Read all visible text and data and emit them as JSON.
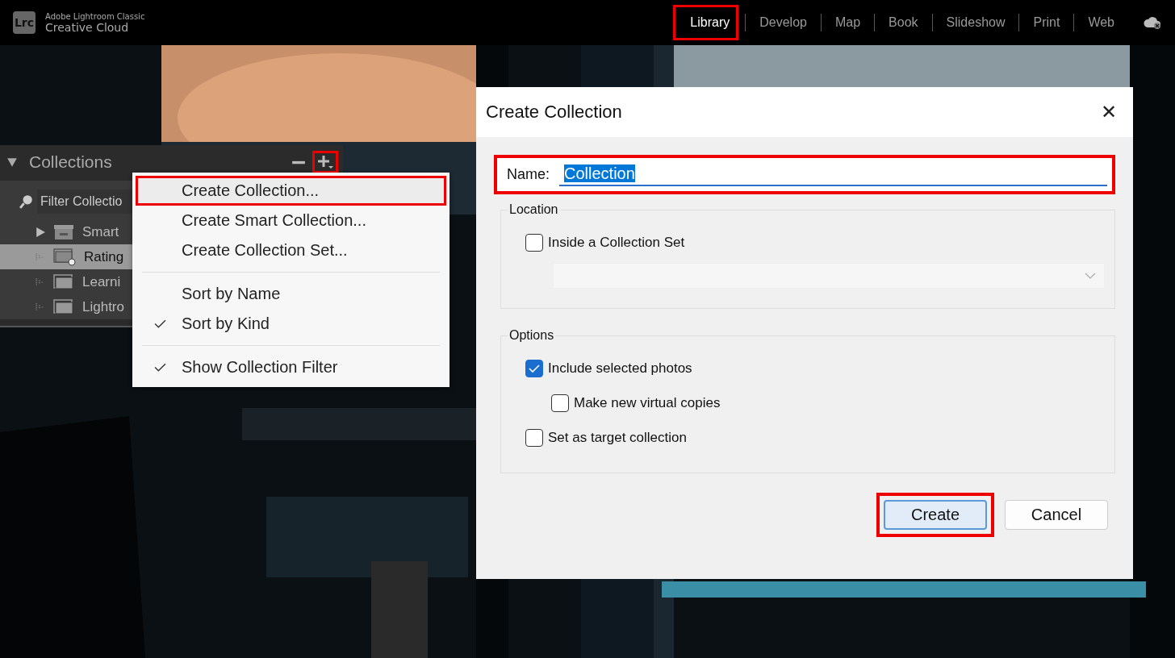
{
  "app": {
    "logo": "Lrc",
    "product": "Adobe Lightroom Classic",
    "suite": "Creative Cloud"
  },
  "modules": [
    {
      "label": "Library",
      "selected": true,
      "highlighted": true
    },
    {
      "label": "Develop",
      "selected": false,
      "highlighted": false
    },
    {
      "label": "Map",
      "selected": false,
      "highlighted": false
    },
    {
      "label": "Book",
      "selected": false,
      "highlighted": false
    },
    {
      "label": "Slideshow",
      "selected": false,
      "highlighted": false
    },
    {
      "label": "Print",
      "selected": false,
      "highlighted": false
    },
    {
      "label": "Web",
      "selected": false,
      "highlighted": false
    }
  ],
  "collections_panel": {
    "title": "Collections",
    "expanded": true,
    "add_highlighted": true,
    "filter_placeholder": "Filter Collectio",
    "items": [
      {
        "label": "Smart",
        "kind": "set",
        "selected": false
      },
      {
        "label": "Rating",
        "kind": "smart",
        "selected": true
      },
      {
        "label": "Learni",
        "kind": "collection",
        "selected": false
      },
      {
        "label": "Lightro",
        "kind": "collection",
        "selected": false
      }
    ]
  },
  "context_menu": {
    "sections": [
      [
        {
          "label": "Create Collection...",
          "checked": false,
          "highlighted": true
        },
        {
          "label": "Create Smart Collection...",
          "checked": false,
          "highlighted": false
        },
        {
          "label": "Create Collection Set...",
          "checked": false,
          "highlighted": false
        }
      ],
      [
        {
          "label": "Sort by Name",
          "checked": false,
          "highlighted": false
        },
        {
          "label": "Sort by Kind",
          "checked": true,
          "highlighted": false
        }
      ],
      [
        {
          "label": "Show Collection Filter",
          "checked": true,
          "highlighted": false
        }
      ]
    ]
  },
  "dialog": {
    "title": "Create Collection",
    "close": "✕",
    "name": {
      "label": "Name:",
      "value": "Collection",
      "highlighted": true
    },
    "location": {
      "title": "Location",
      "checkbox": {
        "label": "Inside a Collection Set",
        "checked": false
      }
    },
    "options": {
      "title": "Options",
      "checkboxes": [
        {
          "label": "Include selected photos",
          "checked": true,
          "children": [
            {
              "label": "Make new virtual copies",
              "checked": false
            }
          ]
        },
        {
          "label": "Set as target collection",
          "checked": false
        }
      ]
    },
    "buttons": [
      {
        "label": "Create",
        "default": true,
        "highlighted": true
      },
      {
        "label": "Cancel",
        "default": false,
        "highlighted": false
      }
    ]
  }
}
